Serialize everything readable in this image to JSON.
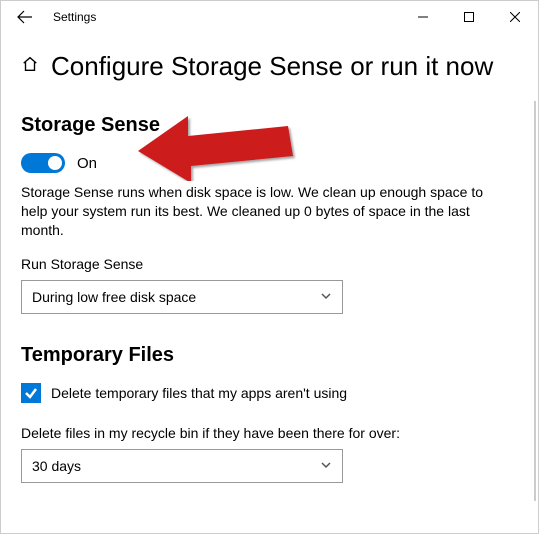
{
  "titlebar": {
    "app_name": "Settings"
  },
  "header": {
    "title": "Configure Storage Sense or run it now"
  },
  "storage_sense": {
    "heading": "Storage Sense",
    "toggle_state": "On",
    "description": "Storage Sense runs when disk space is low. We clean up enough space to help your system run its best. We cleaned up 0 bytes of space in the last month.",
    "run_label": "Run Storage Sense",
    "run_value": "During low free disk space"
  },
  "temp_files": {
    "heading": "Temporary Files",
    "checkbox_label": "Delete temporary files that my apps aren't using",
    "recycle_label": "Delete files in my recycle bin if they have been there for over:",
    "recycle_value": "30 days"
  },
  "annotation": {
    "arrow_color": "#cc1b1b"
  }
}
